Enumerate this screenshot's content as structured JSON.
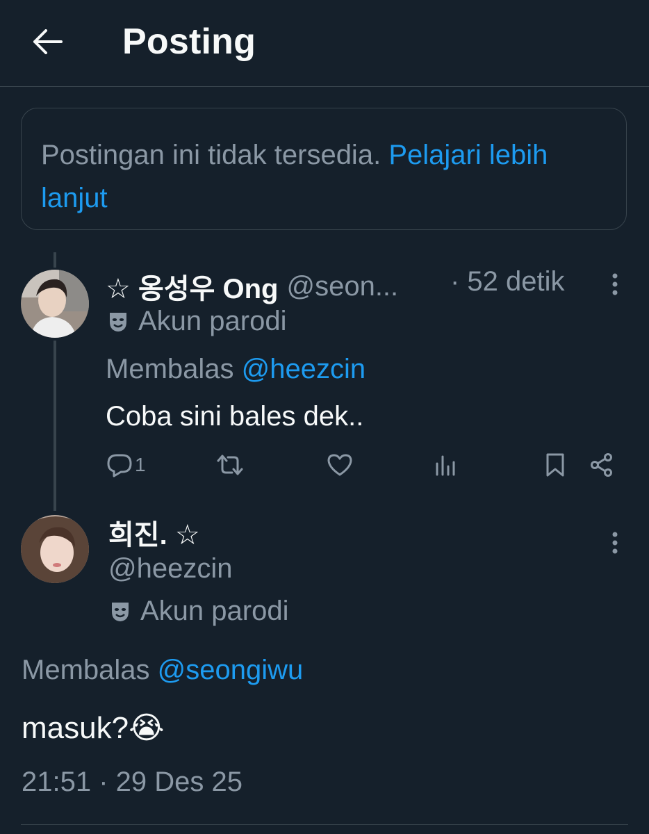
{
  "header": {
    "title": "Posting"
  },
  "notice": {
    "text": "Postingan ini tidak tersedia.",
    "link_label": "Pelajari lebih lanjut"
  },
  "parent_post": {
    "display_name": "☆ 옹성우 Ong",
    "handle": "@seon...",
    "time": "· 52 detik",
    "label": "Akun parodi",
    "replying_prefix": "Membalas",
    "replying_to": "@heezcin",
    "text": "Coba sini bales dek..",
    "reply_count": "1"
  },
  "main_post": {
    "display_name": "희진. ☆",
    "handle": "@heezcin",
    "label": "Akun parodi",
    "replying_prefix": "Membalas",
    "replying_to": "@seongiwu",
    "text": "masuk?😭",
    "timestamp": "21:51 · 29 Des 25"
  },
  "icons": {
    "back": "arrow-left-icon",
    "more": "more-vertical-icon",
    "parody": "theater-mask-icon",
    "reply": "reply-icon",
    "retweet": "repost-icon",
    "like": "heart-icon",
    "views": "bar-chart-icon",
    "bookmark": "bookmark-icon",
    "share": "share-icon"
  },
  "colors": {
    "background": "#15202b",
    "link": "#1d9bf0",
    "secondary_text": "#8b98a5",
    "border": "#38444d"
  }
}
